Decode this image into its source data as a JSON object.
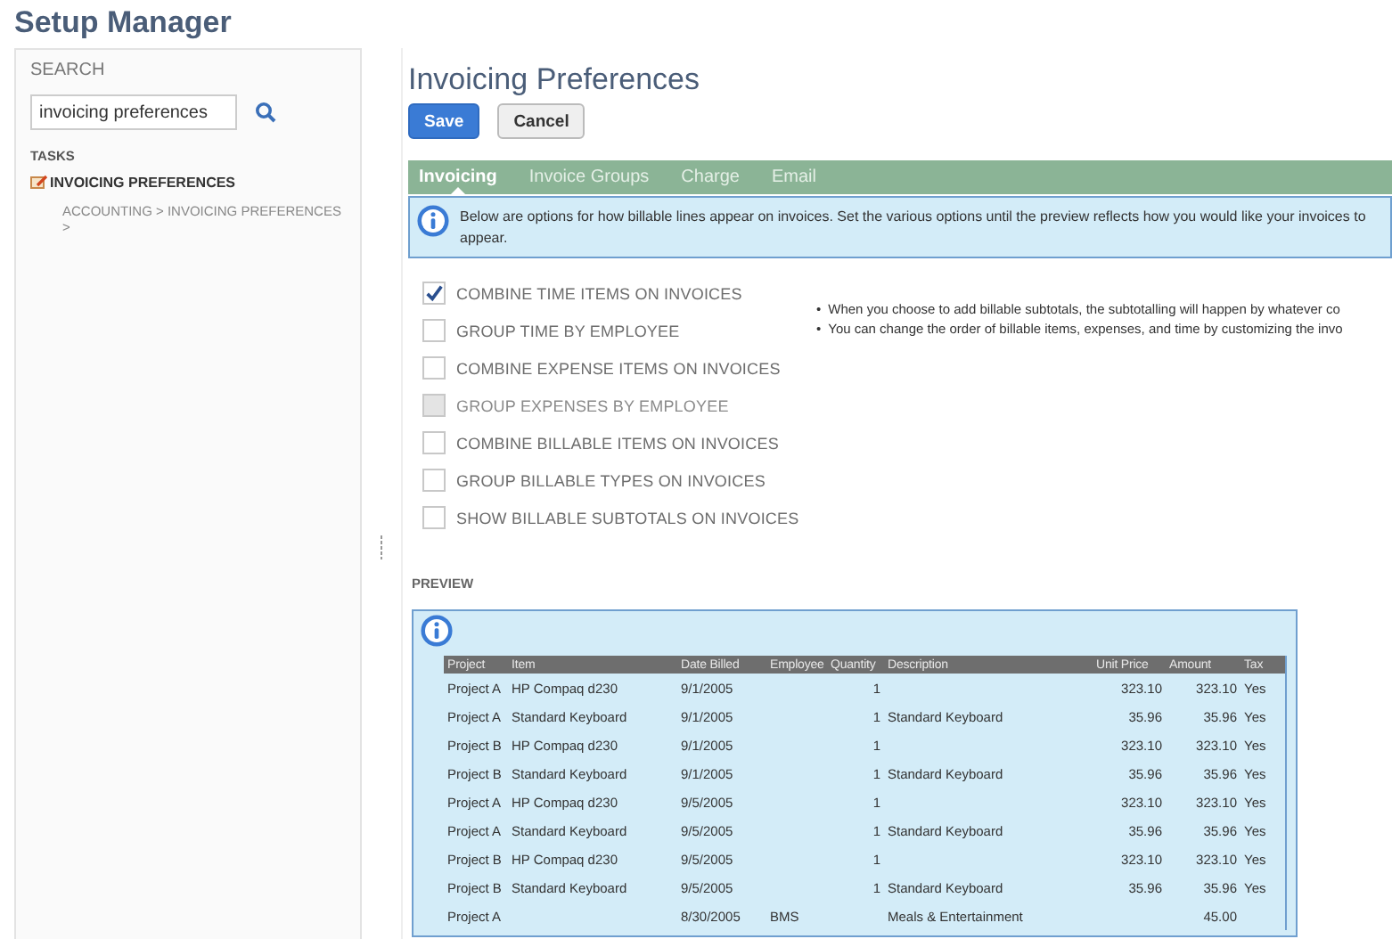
{
  "app_title": "Setup Manager",
  "sidebar": {
    "search_label": "SEARCH",
    "search_value": "invoicing preferences",
    "tasks_label": "TASKS",
    "task": "INVOICING PREFERENCES",
    "breadcrumb": "ACCOUNTING > INVOICING PREFERENCES >"
  },
  "page_title": "Invoicing Preferences",
  "buttons": [
    {
      "label": "Save",
      "kind": "primary"
    },
    {
      "label": "Cancel",
      "kind": "secondary"
    }
  ],
  "tabs": [
    {
      "label": "Invoicing",
      "selected": true
    },
    {
      "label": "Invoice Groups",
      "selected": false
    },
    {
      "label": "Charge",
      "selected": false
    },
    {
      "label": "Email",
      "selected": false
    }
  ],
  "info_banner": "Below are options for how billable lines appear on invoices. Set the various options until the preview reflects how you would like your invoices to appear.",
  "options": [
    {
      "label": "COMBINE TIME ITEMS ON INVOICES",
      "checked": true,
      "disabled": false
    },
    {
      "label": "GROUP TIME BY EMPLOYEE",
      "checked": false,
      "disabled": false
    },
    {
      "label": "COMBINE EXPENSE ITEMS ON INVOICES",
      "checked": false,
      "disabled": false
    },
    {
      "label": "GROUP EXPENSES BY EMPLOYEE",
      "checked": false,
      "disabled": true
    },
    {
      "label": "COMBINE BILLABLE ITEMS ON INVOICES",
      "checked": false,
      "disabled": false
    },
    {
      "label": "GROUP BILLABLE TYPES ON INVOICES",
      "checked": false,
      "disabled": false
    },
    {
      "label": "SHOW BILLABLE SUBTOTALS ON INVOICES",
      "checked": false,
      "disabled": false
    }
  ],
  "notes": [
    {
      "bullet": "•",
      "text": "When you choose to add billable subtotals, the subtotalling will happen by whatever co"
    },
    {
      "bullet": "•",
      "text": "You can change the order of billable items, expenses, and time by customizing the invo"
    }
  ],
  "preview": {
    "label": "PREVIEW",
    "columns": [
      "Project",
      "Item",
      "Date Billed",
      "Employee",
      "Quantity",
      "Description",
      "Unit Price",
      "Amount",
      "Tax"
    ],
    "rows": [
      [
        "Project A",
        "HP Compaq d230",
        "9/1/2005",
        "",
        "1",
        "",
        "323.10",
        "323.10",
        "Yes"
      ],
      [
        "Project A",
        "Standard Keyboard",
        "9/1/2005",
        "",
        "1",
        "Standard Keyboard",
        "35.96",
        "35.96",
        "Yes"
      ],
      [
        "Project B",
        "HP Compaq d230",
        "9/1/2005",
        "",
        "1",
        "",
        "323.10",
        "323.10",
        "Yes"
      ],
      [
        "Project B",
        "Standard Keyboard",
        "9/1/2005",
        "",
        "1",
        "Standard Keyboard",
        "35.96",
        "35.96",
        "Yes"
      ],
      [
        "Project A",
        "HP Compaq d230",
        "9/5/2005",
        "",
        "1",
        "",
        "323.10",
        "323.10",
        "Yes"
      ],
      [
        "Project A",
        "Standard Keyboard",
        "9/5/2005",
        "",
        "1",
        "Standard Keyboard",
        "35.96",
        "35.96",
        "Yes"
      ],
      [
        "Project B",
        "HP Compaq d230",
        "9/5/2005",
        "",
        "1",
        "",
        "323.10",
        "323.10",
        "Yes"
      ],
      [
        "Project B",
        "Standard Keyboard",
        "9/5/2005",
        "",
        "1",
        "Standard Keyboard",
        "35.96",
        "35.96",
        "Yes"
      ],
      [
        "Project A",
        "",
        "8/30/2005",
        "BMS",
        "",
        "Meals & Entertainment",
        "",
        "45.00",
        ""
      ]
    ]
  }
}
